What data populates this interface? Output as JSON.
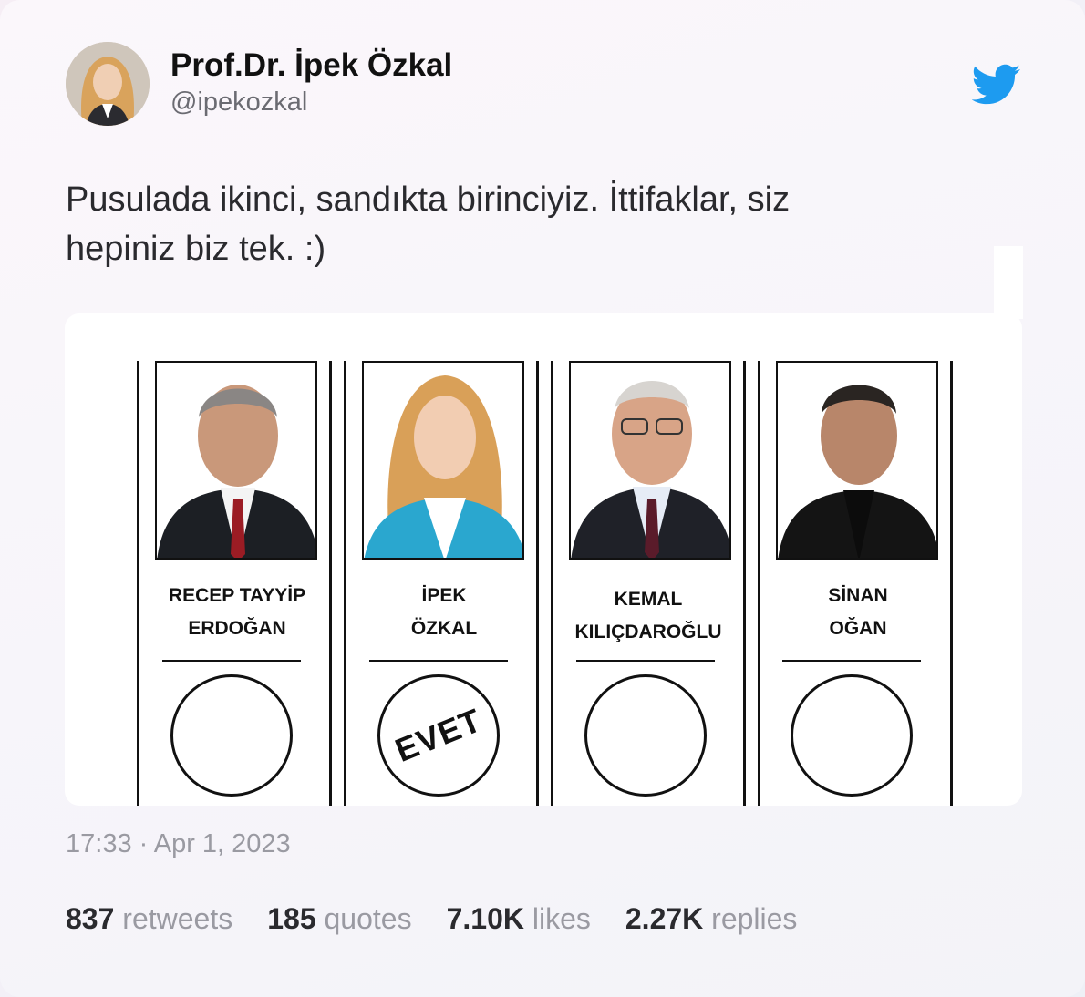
{
  "author": {
    "display_name": "Prof.Dr. İpek Özkal",
    "handle": "@ipekozkal",
    "avatar_icon": "profile-photo"
  },
  "brand": {
    "icon": "twitter-bird-icon",
    "color": "#1d9bf0"
  },
  "tweet": {
    "text": "Pusulada ikinci, sandıkta birinciyiz. İttifaklar, siz\nhepiniz biz tek. :)",
    "timestamp": "17:33 · Apr 1, 2023"
  },
  "ballot": {
    "candidates": [
      {
        "line1": "RECEP TAYYİP",
        "line2": "ERDOĞAN",
        "stamp": ""
      },
      {
        "line1": "İPEK",
        "line2": "ÖZKAL",
        "stamp": "EVET"
      },
      {
        "line1": "KEMAL",
        "line2": "KILIÇDAROĞLU",
        "stamp": ""
      },
      {
        "line1": "SİNAN",
        "line2": "OĞAN",
        "stamp": ""
      }
    ]
  },
  "stats": {
    "retweets_count": "837",
    "retweets_label": "retweets",
    "quotes_count": "185",
    "quotes_label": "quotes",
    "likes_count": "7.10K",
    "likes_label": "likes",
    "replies_count": "2.27K",
    "replies_label": "replies"
  }
}
